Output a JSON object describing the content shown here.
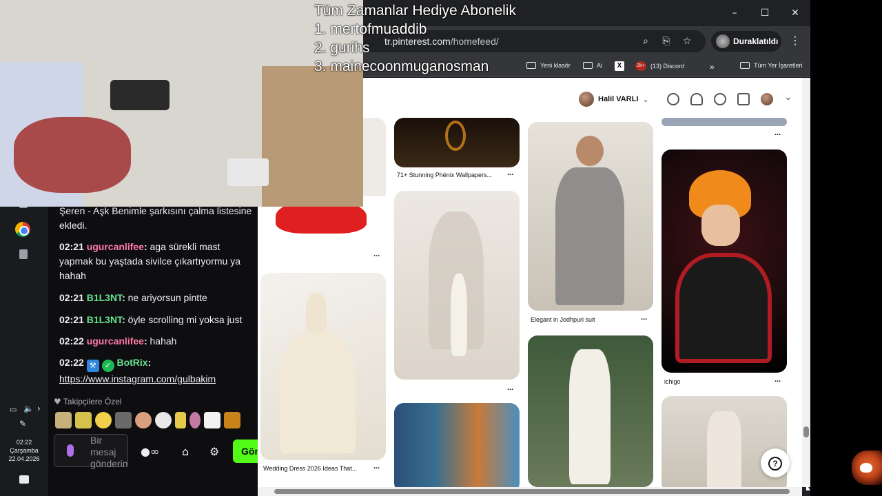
{
  "overlay": {
    "title": "Tüm Zamanlar Hediye  Abonelik",
    "lines": [
      "1. mertofmuaddib",
      "2. gurihs",
      "3. mainecoonmuganosman"
    ]
  },
  "browser": {
    "url_domain": "tr.pinterest.com",
    "url_path": "/homefeed/",
    "paused_label": "Duraklatıldı",
    "window_controls": [
      "–",
      "☐",
      "✕"
    ],
    "bookmarks": [
      "Yeni klasör",
      "Ai",
      "(13) Discord",
      "Tüm Yer İşaretleri"
    ],
    "discord_badge": "2k+"
  },
  "pinterest": {
    "user_name": "Halil VARLI",
    "pins": [
      {
        "caption": "71+ Stunning Phénix Wallpapers..."
      },
      {
        "caption": "Elegant in Jodhpuri suit"
      },
      {
        "caption": "ichigo"
      },
      {
        "caption": "Wedding Dress 2026 Ideas That..."
      }
    ],
    "more": "...",
    "help": "?"
  },
  "chat": {
    "partial_message": "Şeren - Aşk Benimle şarkısını çalma listesine ekledi.",
    "messages": [
      {
        "time": "02:21",
        "user": "ugurcanlifee",
        "text": "aga sürekli mast yapmak bu yaştada sivilce çıkartıyormu ya hahah"
      },
      {
        "time": "02:21",
        "user": "B1L3NT",
        "text": "ne ariyorsun pintte"
      },
      {
        "time": "02:21",
        "user": "B1L3NT",
        "text": "öyle scrolling mi yoksa just"
      },
      {
        "time": "02:22",
        "user": "ugurcanlifee",
        "text": "hahah"
      },
      {
        "time": "02:22",
        "user": "BotRix",
        "text": "https://www.instagram.com/gulbakim"
      }
    ],
    "followers_label": "Takipçilere Özel",
    "input_placeholder": "Bir mesaj gönderin",
    "send_label": "Gönder"
  },
  "taskbar": {
    "time": "02:22",
    "day": "Çarşamba",
    "date": "22.04.2026"
  }
}
